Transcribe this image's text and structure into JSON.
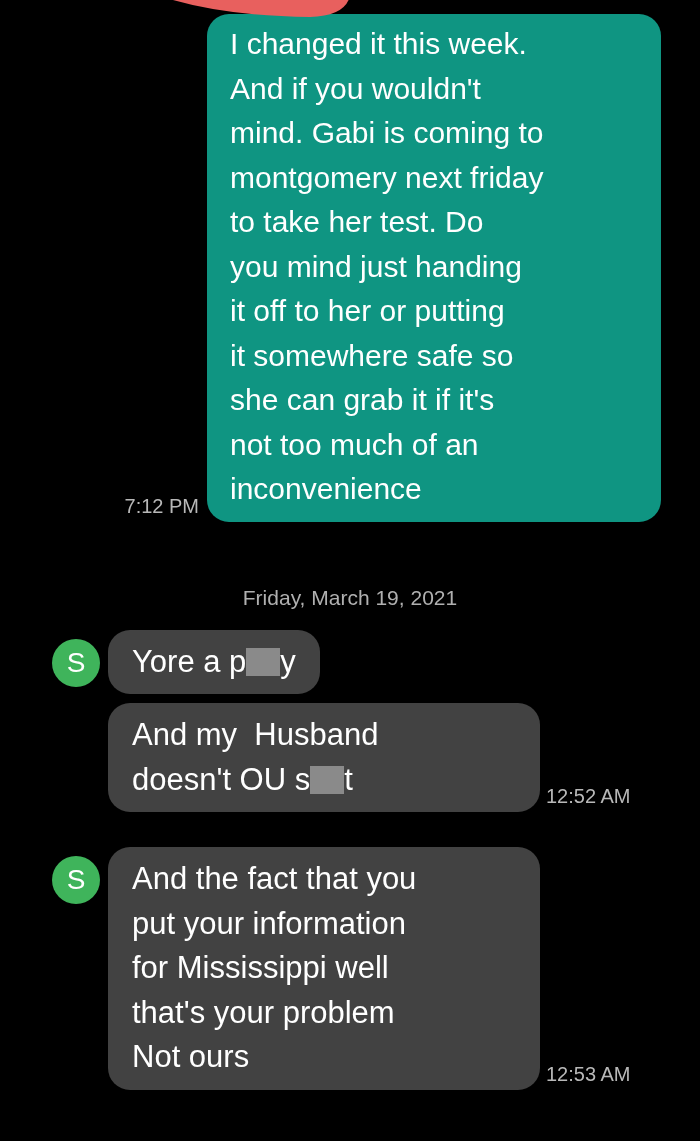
{
  "conversation": [
    {
      "kind": "sent",
      "lines": [
        "I changed it this week.",
        "And if you wouldn't",
        "mind. Gabi is coming to",
        "montgomery next friday",
        "to take her test. Do",
        "you mind just handing",
        "it off to her or putting",
        "it somewhere safe so",
        "she can grab it if it's",
        "not too much of an",
        "inconvenience"
      ],
      "time": "7:12 PM"
    },
    {
      "kind": "date",
      "text": "Friday, March 19, 2021"
    },
    {
      "kind": "received",
      "avatar": "S",
      "messages": [
        {
          "lines": [
            [
              "Yore a p",
              "y"
            ]
          ]
        },
        {
          "lines": [
            [
              "And my  Husband"
            ],
            [
              "doesn't OU s",
              "t"
            ]
          ],
          "time": "12:52 AM"
        }
      ]
    },
    {
      "kind": "received",
      "avatar": "S",
      "messages": [
        {
          "lines": [
            [
              "And the fact that you"
            ],
            [
              "put your information"
            ],
            [
              "for Mississippi well"
            ],
            [
              "that's your problem"
            ],
            [
              "Not ours"
            ]
          ],
          "time": "12:53 AM"
        }
      ]
    }
  ]
}
